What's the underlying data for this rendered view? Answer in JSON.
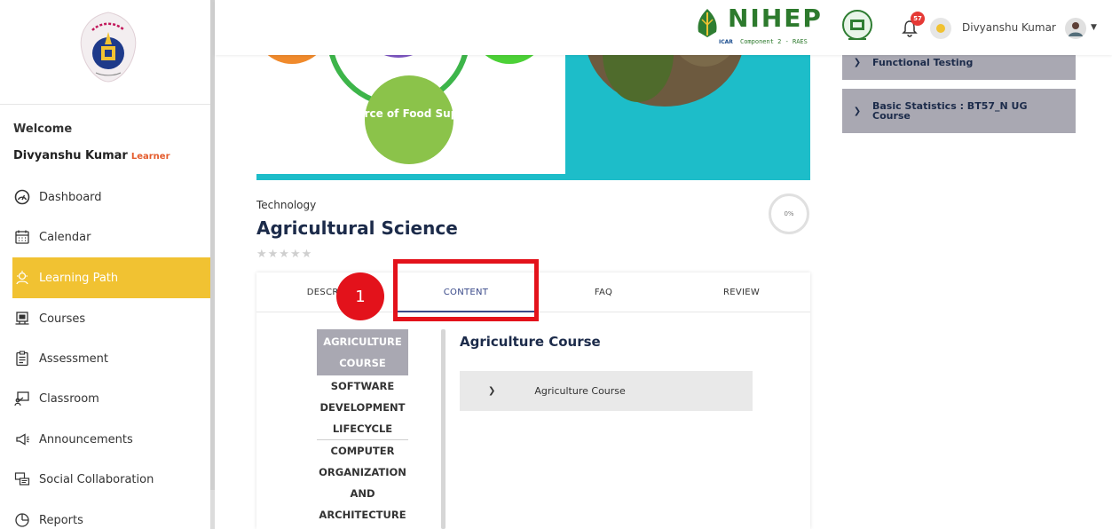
{
  "sidebar": {
    "welcome_label": "Welcome",
    "user_name": "Divyanshu Kumar",
    "user_role": "Learner",
    "items": [
      {
        "label": "Dashboard",
        "icon": "gauge-icon"
      },
      {
        "label": "Calendar",
        "icon": "calendar-icon"
      },
      {
        "label": "Learning Path",
        "icon": "learning-path-icon",
        "active": true
      },
      {
        "label": "Courses",
        "icon": "courses-icon"
      },
      {
        "label": "Assessment",
        "icon": "clipboard-icon"
      },
      {
        "label": "Classroom",
        "icon": "classroom-icon"
      },
      {
        "label": "Announcements",
        "icon": "megaphone-icon"
      },
      {
        "label": "Social Collaboration",
        "icon": "chat-icon"
      },
      {
        "label": "Reports",
        "icon": "pie-chart-icon"
      }
    ]
  },
  "header": {
    "brand_text": "NIHEP",
    "brand_sub": "Component 2 - RAES",
    "brand_icar": "ICAR",
    "notification_count": "57",
    "user_name": "Divyanshu Kumar"
  },
  "banner": {
    "circle_label": "Source of Food Supply"
  },
  "course": {
    "category": "Technology",
    "title": "Agricultural Science",
    "stars": "★★★★★",
    "progress": "0%"
  },
  "tabs": [
    {
      "label": "DESCRIPTION",
      "visible_label": "DESCRIP"
    },
    {
      "label": "CONTENT",
      "active": true
    },
    {
      "label": "FAQ"
    },
    {
      "label": "REVIEW"
    }
  ],
  "callout": {
    "number": "1"
  },
  "modules": {
    "active_lines": [
      "AGRICULTURE",
      "COURSE"
    ],
    "item2_lines": [
      "SOFTWARE",
      "DEVELOPMENT",
      "LIFECYCLE"
    ],
    "item3_lines": [
      "COMPUTER",
      "ORGANIZATION",
      "AND",
      "ARCHITECTURE"
    ]
  },
  "content": {
    "title": "Agriculture Course",
    "accordion_label": "Agriculture Course"
  },
  "right_column": [
    {
      "label": "Functional Testing"
    },
    {
      "label": "Basic Statistics : BT57_N UG Course"
    }
  ],
  "colors": {
    "accent_yellow": "#f1c232",
    "callout_red": "#e3121b",
    "navy": "#1c2b4a",
    "module_gray": "#a9a8b2"
  }
}
